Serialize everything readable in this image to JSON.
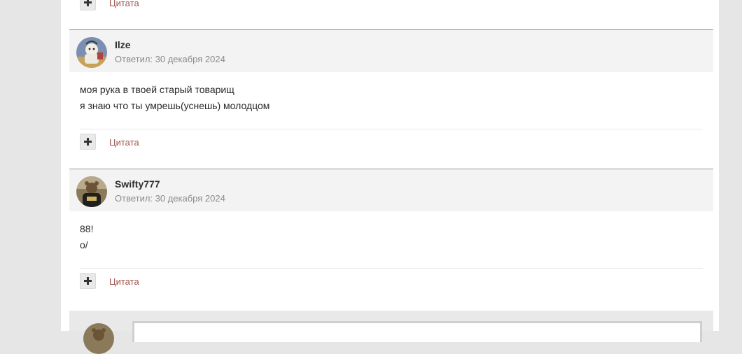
{
  "posts": [
    {
      "author": "Ilze",
      "replied": "Ответил: 30 декабря 2024",
      "lines": [
        "моя рука в твоей старый товарищ",
        "я знаю что ты умрешь(уснешь) молодцом"
      ],
      "quote_label": "Цитата",
      "avatar_icon": "cartoon-avatar-icon"
    },
    {
      "author": "Swifty777",
      "replied": "Ответил: 30 декабря 2024",
      "lines": [
        "88!",
        "o/"
      ],
      "quote_label": "Цитата",
      "avatar_icon": "photo-avatar-icon"
    }
  ],
  "top_fragment": {
    "quote_label": "Цитата"
  },
  "colors": {
    "accent_link": "#a0524a",
    "header_bg": "#f3f3f3",
    "page_bg": "#e6e6e6"
  }
}
